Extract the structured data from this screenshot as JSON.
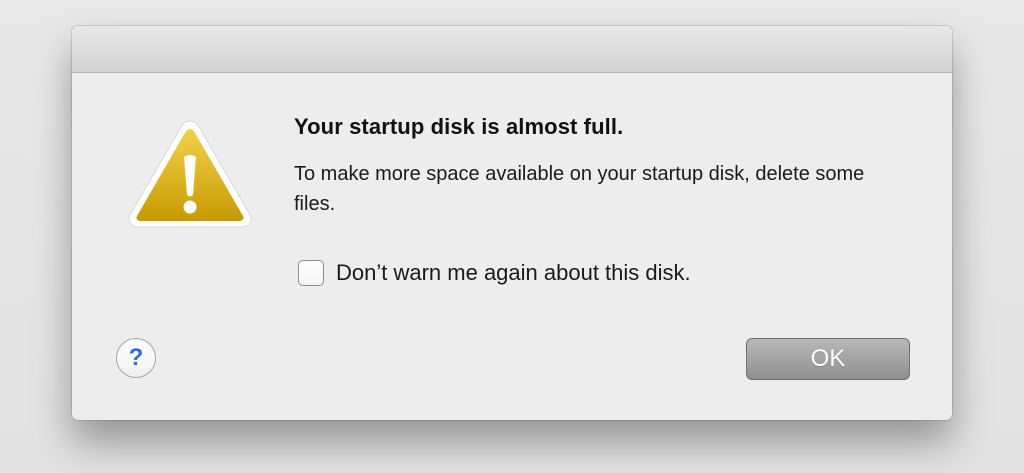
{
  "dialog": {
    "title": "Your startup disk is almost full.",
    "message": "To make more space available on your startup disk, delete some files.",
    "icon": "warning-triangle-icon",
    "checkbox": {
      "label": "Don’t warn me again about this disk.",
      "checked": false
    },
    "help_button": {
      "label": "?",
      "icon": "help-icon"
    },
    "ok_button": {
      "label": "OK"
    },
    "colors": {
      "warning_yellow": "#e3b700",
      "help_blue": "#2a6fe6",
      "ok_button_gray": "#a3a3a3"
    }
  }
}
